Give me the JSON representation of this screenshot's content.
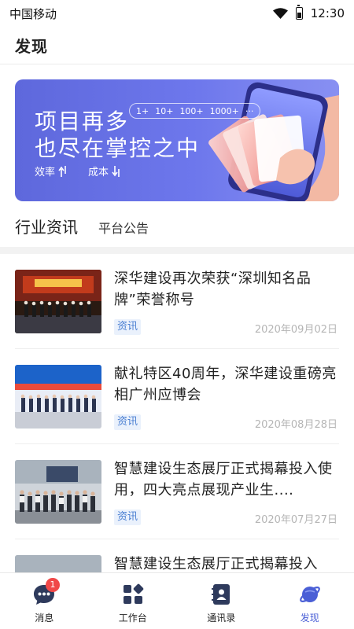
{
  "status_bar": {
    "carrier": "中国移动",
    "time": "12:30"
  },
  "header": {
    "title": "发现"
  },
  "banner": {
    "line1": "项目再多",
    "line2": "也尽在掌控之中",
    "counter": [
      "1+",
      "10+",
      "100+",
      "1000+",
      "···"
    ],
    "tag1": "效率",
    "tag2": "成本"
  },
  "tabs": [
    {
      "label": "行业资讯",
      "active": true
    },
    {
      "label": "平台公告",
      "active": false
    }
  ],
  "news": [
    {
      "title": "深华建设再次荣获“深圳知名品牌”荣誉称号",
      "tag": "资讯",
      "date": "2020年09月02日"
    },
    {
      "title": "献礼特区40周年，深华建设重磅亮相广州应博会",
      "tag": "资讯",
      "date": "2020年08月28日"
    },
    {
      "title": "智慧建设生态展厅正式揭幕投入使用，四大亮点展现产业生....",
      "tag": "资讯",
      "date": "2020年07月27日"
    },
    {
      "title": "智慧建设生态展厅正式揭幕投入",
      "tag": "",
      "date": ""
    }
  ],
  "bottom_nav": [
    {
      "label": "消息",
      "icon": "message-icon",
      "badge": "1"
    },
    {
      "label": "工作台",
      "icon": "workbench-icon"
    },
    {
      "label": "通讯录",
      "icon": "contacts-icon"
    },
    {
      "label": "发现",
      "icon": "discover-planet-icon",
      "active": true
    }
  ],
  "colors": {
    "accent": "#4a5fd6",
    "banner": "#6d77ec",
    "badge": "#f04848",
    "tag_bg": "#eaf1fc",
    "tag_text": "#4a7fd2"
  }
}
